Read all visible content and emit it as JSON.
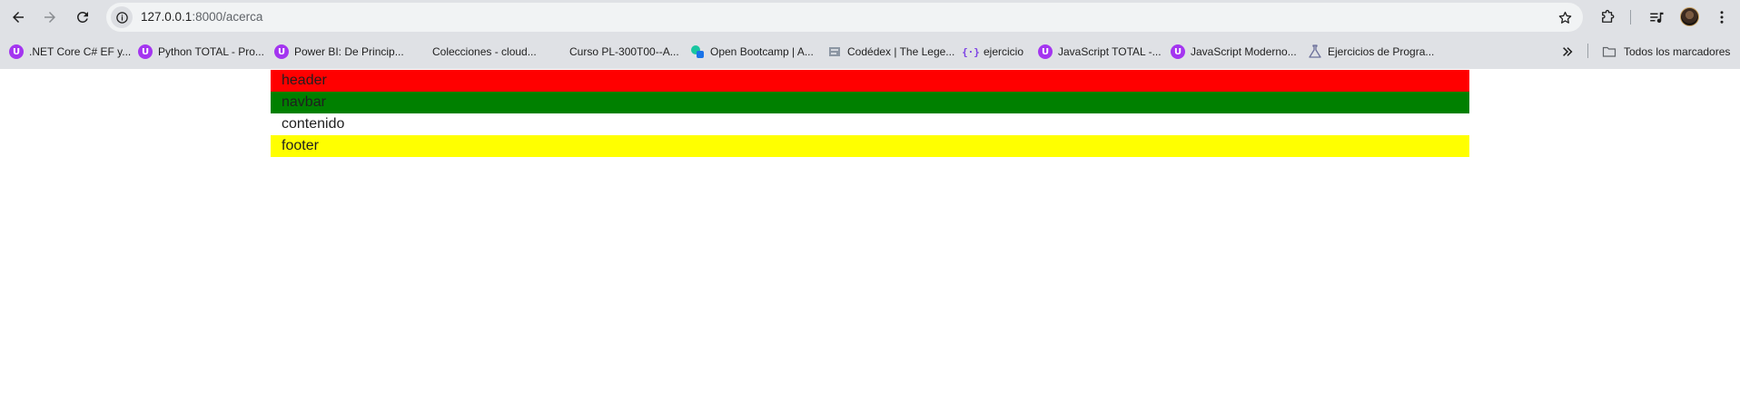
{
  "browser": {
    "url_host": "127.0.0.1",
    "url_path": ":8000/acerca",
    "icons": {
      "back": "arrow-left-icon",
      "forward": "arrow-right-icon",
      "reload": "reload-icon",
      "site_info": "info-icon",
      "bookmark_star": "star-icon",
      "extensions": "puzzle-icon",
      "media": "media-control-icon",
      "profile": "avatar",
      "menu": "kebab-menu-icon"
    }
  },
  "bookmarks": {
    "items": [
      {
        "label": ".NET Core C# EF y...",
        "icon": "udemy-icon"
      },
      {
        "label": "Python TOTAL - Pro...",
        "icon": "udemy-icon"
      },
      {
        "label": "Power BI: De Princip...",
        "icon": "udemy-icon"
      },
      {
        "label": "Colecciones - cloud...",
        "icon": "microsoft-icon"
      },
      {
        "label": "Curso PL-300T00--A...",
        "icon": "microsoft-icon"
      },
      {
        "label": "Open Bootcamp | A...",
        "icon": "openbootcamp-icon"
      },
      {
        "label": "Codédex | The Lege...",
        "icon": "codedex-icon"
      },
      {
        "label": "ejercicio",
        "icon": "code-braces-icon"
      },
      {
        "label": "JavaScript TOTAL -...",
        "icon": "udemy-icon"
      },
      {
        "label": "JavaScript Moderno...",
        "icon": "udemy-icon"
      },
      {
        "label": "Ejercicios de Progra...",
        "icon": "flask-icon"
      }
    ],
    "more_icon": "double-chevron-icon",
    "all_bookmarks": "Todos los marcadores"
  },
  "page": {
    "rows": [
      {
        "label": "header",
        "color": "#ff0000"
      },
      {
        "label": "navbar",
        "color": "#008000"
      },
      {
        "label": "contenido",
        "color": "#ffffff"
      },
      {
        "label": "footer",
        "color": "#ffff00"
      }
    ]
  }
}
